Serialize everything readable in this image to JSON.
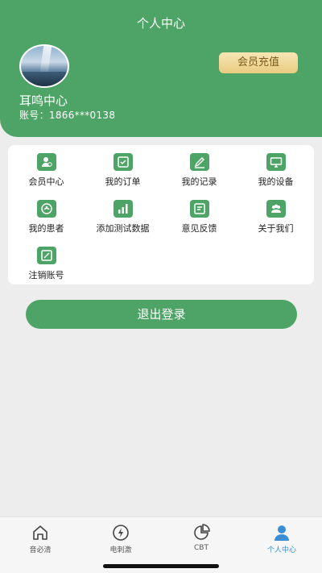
{
  "header": {
    "title": "个人中心",
    "username": "耳鸣中心",
    "account": "账号：1866***0138",
    "recharge_label": "会员充值"
  },
  "menu": [
    {
      "label": "会员中心",
      "icon": "member-icon"
    },
    {
      "label": "我的订单",
      "icon": "order-icon"
    },
    {
      "label": "我的记录",
      "icon": "record-icon"
    },
    {
      "label": "我的设备",
      "icon": "device-icon"
    },
    {
      "label": "我的患者",
      "icon": "patient-icon"
    },
    {
      "label": "添加测试数据",
      "icon": "chart-bars-icon"
    },
    {
      "label": "意见反馈",
      "icon": "feedback-icon"
    },
    {
      "label": "关于我们",
      "icon": "about-icon"
    },
    {
      "label": "注销账号",
      "icon": "cancel-account-icon"
    }
  ],
  "logout_label": "退出登录",
  "tabs": [
    {
      "label": "音必清",
      "icon": "home-icon",
      "active": false
    },
    {
      "label": "电刺激",
      "icon": "lightning-icon",
      "active": false
    },
    {
      "label": "CBT",
      "icon": "pie-chart-icon",
      "active": false
    },
    {
      "label": "个人中心",
      "icon": "user-icon",
      "active": true
    }
  ],
  "colors": {
    "primary": "#4ea466",
    "gold": "#e8cb80",
    "active_tab": "#3a8fd4"
  }
}
